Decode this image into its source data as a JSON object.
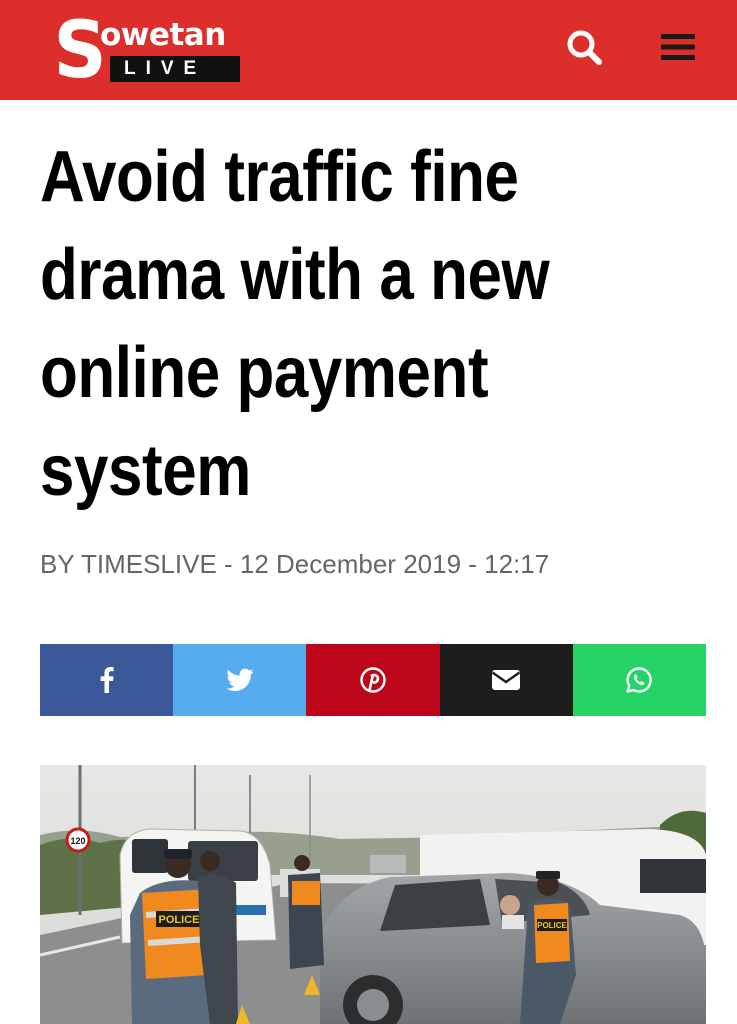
{
  "header": {
    "brand": {
      "letter": "S",
      "word": "owetan",
      "sub": "LIVE"
    },
    "bg_color": "#dc2f2b",
    "search_icon": "search-icon",
    "menu_icon": "hamburger-menu-icon"
  },
  "article": {
    "headline_lines": [
      "Avoid traffic fine",
      "drama with a new",
      "online payment",
      "system"
    ],
    "byline": "BY TIMESLIVE - 12 December 2019 - 12:17"
  },
  "share": [
    {
      "network": "facebook",
      "icon": "facebook-icon",
      "color": "#3b5998"
    },
    {
      "network": "twitter",
      "icon": "twitter-icon",
      "color": "#55acee"
    },
    {
      "network": "pinterest",
      "icon": "pinterest-icon",
      "color": "#bd081c"
    },
    {
      "network": "email",
      "icon": "envelope-icon",
      "color": "#1d1d1b"
    },
    {
      "network": "whatsapp",
      "icon": "whatsapp-icon",
      "color": "#25d366"
    }
  ],
  "hero_image": {
    "signs": [
      "POLICE",
      "POLICE"
    ],
    "speed_sign": "120"
  }
}
